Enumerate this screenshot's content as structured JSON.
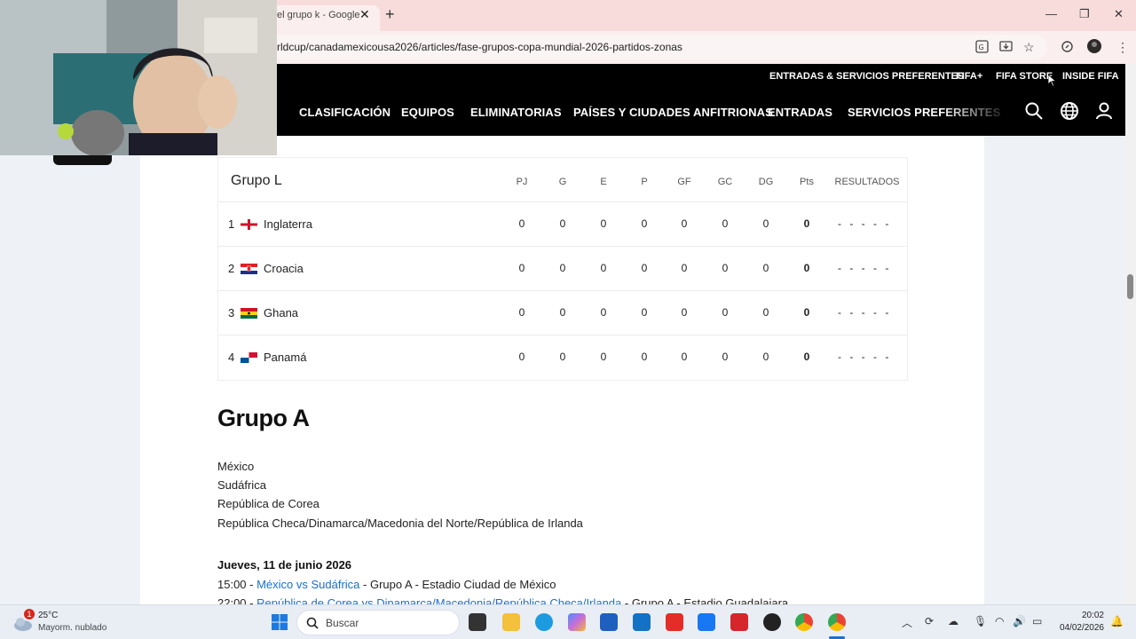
{
  "browser": {
    "tab_title": "el grupo k - Google",
    "tab_close": "✕",
    "new_tab": "+",
    "url": "rldcup/canadamexicousa2026/articles/fase-grupos-copa-mundial-2026-partidos-zonas",
    "minimize": "—",
    "maximize": "❐",
    "close": "✕"
  },
  "fifa_top": [
    "ENTRADAS & SERVICIOS PREFERENTES",
    "FIFA+",
    "FIFA STORE",
    "INSIDE FIFA"
  ],
  "fifa_nav": [
    "CLASIFICACIÓN",
    "EQUIPOS",
    "ELIMINATORIAS",
    "PAÍSES Y CIUDADES ANFITRIONAS",
    "ENTRADAS",
    "SERVICIOS PREFERENTES"
  ],
  "group_table": {
    "title": "Grupo L",
    "columns": [
      "PJ",
      "G",
      "E",
      "P",
      "GF",
      "GC",
      "DG",
      "Pts",
      "RESULTADOS"
    ],
    "rows": [
      {
        "rank": "1",
        "team": "Inglaterra",
        "flag": "england",
        "stats": [
          "0",
          "0",
          "0",
          "0",
          "0",
          "0",
          "0",
          "0"
        ],
        "results": "- - - - -"
      },
      {
        "rank": "2",
        "team": "Croacia",
        "flag": "croatia",
        "stats": [
          "0",
          "0",
          "0",
          "0",
          "0",
          "0",
          "0",
          "0"
        ],
        "results": "- - - - -"
      },
      {
        "rank": "3",
        "team": "Ghana",
        "flag": "ghana",
        "stats": [
          "0",
          "0",
          "0",
          "0",
          "0",
          "0",
          "0",
          "0"
        ],
        "results": "- - - - -"
      },
      {
        "rank": "4",
        "team": "Panamá",
        "flag": "panama",
        "stats": [
          "0",
          "0",
          "0",
          "0",
          "0",
          "0",
          "0",
          "0"
        ],
        "results": "- - - - -"
      }
    ]
  },
  "group_a": {
    "heading": "Grupo A",
    "teams": [
      "México",
      "Sudáfrica",
      "República de Corea",
      "República Checa/Dinamarca/Macedonia del Norte/República de Irlanda"
    ],
    "date": "Jueves, 11 de junio 2026",
    "matches": [
      {
        "time": "15:00 - ",
        "link": "México vs Sudáfrica",
        "rest": " - Grupo A - Estadio Ciudad de México"
      },
      {
        "time": "22:00 - ",
        "link": "República de Corea vs Dinamarca/Macedonia/República Checa/Irlanda",
        "rest": " - Grupo A - Estadio Guadalajara"
      }
    ]
  },
  "taskbar": {
    "temp": "25°C",
    "weather": "Mayorm. nublado",
    "weather_badge": "1",
    "search_placeholder": "Buscar",
    "time": "20:02",
    "date": "04/02/2026"
  }
}
